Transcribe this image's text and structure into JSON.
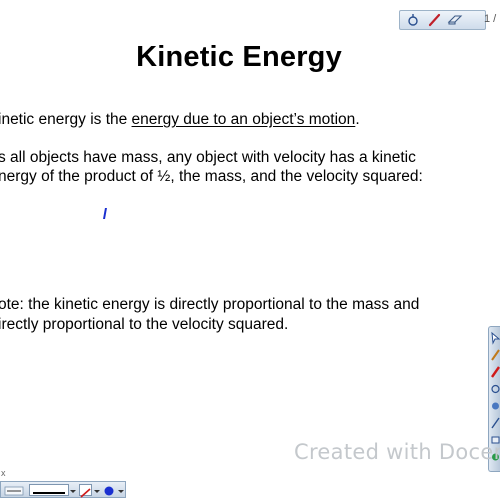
{
  "toolbar": {
    "page_indicator": "1 /",
    "tools": [
      "pointer-icon",
      "pen-icon",
      "eraser-icon"
    ]
  },
  "slide": {
    "title": "Kinetic Energy",
    "definition": {
      "prefix": "inetic energy is the ",
      "underlined": "energy due to an object’s motion",
      "suffix": "."
    },
    "statement_lines": [
      "s all objects have mass, any object with velocity has a kinetic",
      "nergy of the product of ½, the mass, and the velocity squared:"
    ],
    "note_lines": [
      "ote:  the kinetic energy is directly proportional to the mass and",
      "irectly proportional to the velocity squared."
    ]
  },
  "watermark": "Created with Docer",
  "corner_mark": "x",
  "colors": {
    "pen_blue": "#1a2fd0",
    "pen_red": "#d01a1a",
    "toolbar_border": "#8ea6bf",
    "watermark": "#c4c8cc"
  }
}
